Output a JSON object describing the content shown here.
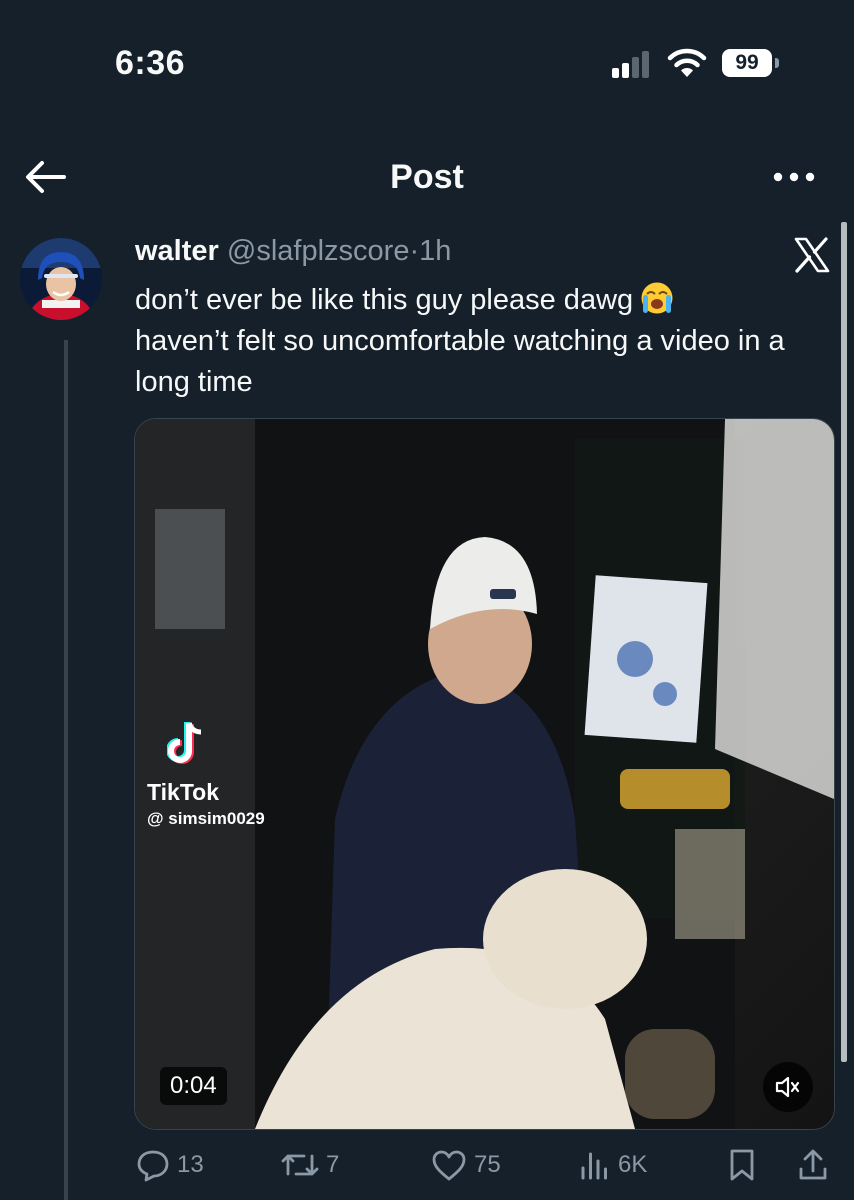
{
  "status_bar": {
    "time": "6:36",
    "battery": "99"
  },
  "header": {
    "title": "Post"
  },
  "tweet": {
    "name": "walter",
    "handle": "@slafplzscore",
    "separator": "·",
    "age": "1h",
    "text_line1": "don’t ever be like this guy please dawg",
    "text_rest": "haven’t felt so uncomfortable watching a video in a long time"
  },
  "media": {
    "watermark_name": "TikTok",
    "watermark_user": "@ simsim0029",
    "duration": "0:04"
  },
  "actions": {
    "replies": "13",
    "reposts": "7",
    "likes": "75",
    "views": "6K"
  },
  "icons": [
    "back-arrow-icon",
    "more-icon",
    "x-logo-icon",
    "loudly-crying-emoji-icon",
    "tiktok-icon",
    "mute-icon",
    "reply-icon",
    "repost-icon",
    "like-icon",
    "views-icon",
    "bookmark-icon",
    "share-icon"
  ],
  "colors": {
    "background": "#15202b",
    "text": "#f7f9f9",
    "secondary_text": "#8b98a5",
    "divider": "#38444d"
  }
}
